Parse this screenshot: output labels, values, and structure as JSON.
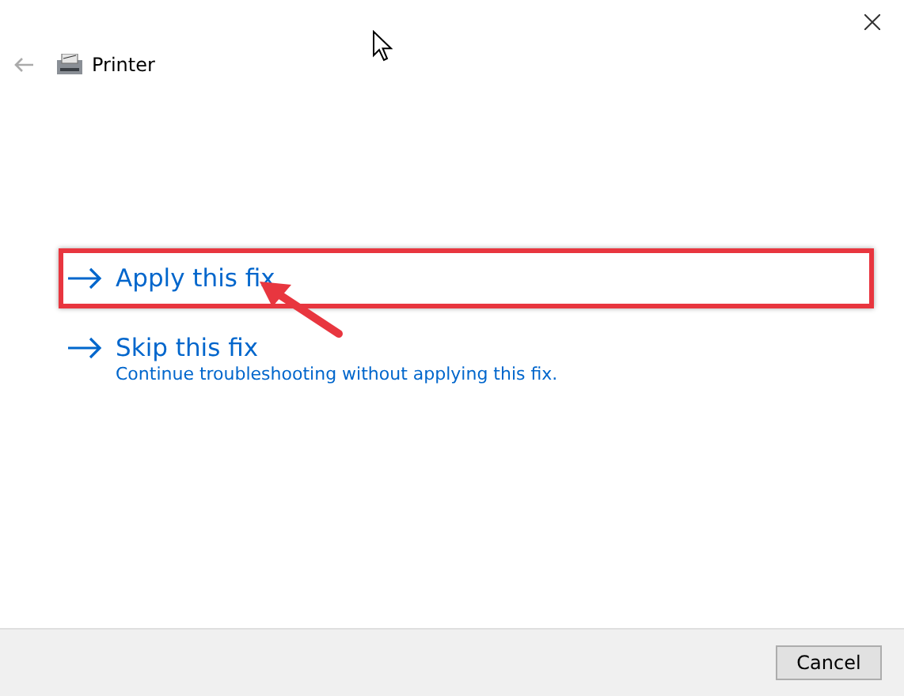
{
  "window": {
    "title": "Printer"
  },
  "options": [
    {
      "label": "Apply this fix",
      "highlighted": true
    },
    {
      "label": "Skip this fix",
      "description": "Continue troubleshooting without applying this fix.",
      "highlighted": false
    }
  ],
  "buttons": [
    "Cancel"
  ]
}
